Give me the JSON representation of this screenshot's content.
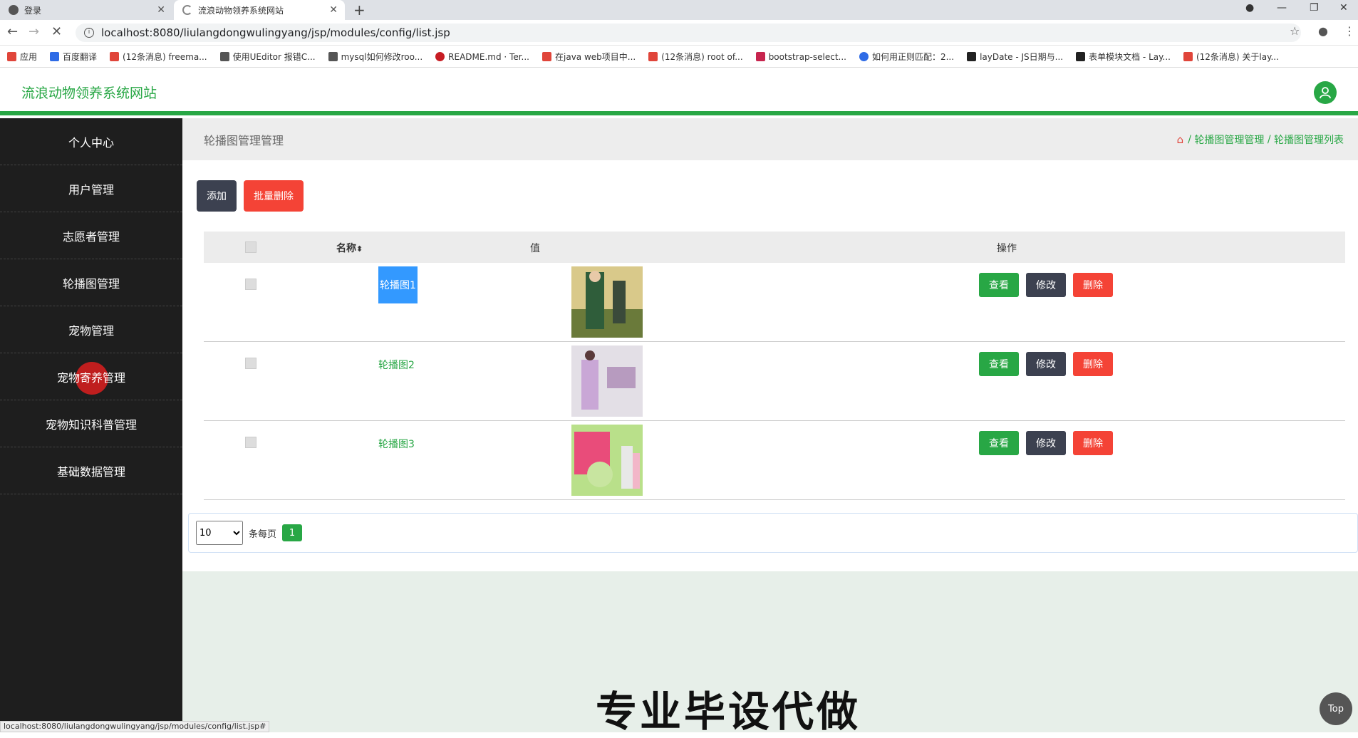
{
  "browser": {
    "tabs": [
      {
        "title": "登录"
      },
      {
        "title": "流浪动物领养系统网站"
      }
    ],
    "url": "localhost:8080/liulangdongwulingyang/jsp/modules/config/list.jsp",
    "bookmarks": [
      {
        "label": "应用",
        "color": "#e0453a"
      },
      {
        "label": "百度翻译",
        "color": "#2e6be6"
      },
      {
        "label": "(12条消息) freema...",
        "color": "#e0453a"
      },
      {
        "label": "使用UEditor 报错C...",
        "color": "#555555"
      },
      {
        "label": "mysql如何修改roo...",
        "color": "#555555"
      },
      {
        "label": "README.md · Ter...",
        "color": "#c71d23"
      },
      {
        "label": "在java web项目中...",
        "color": "#e0453a"
      },
      {
        "label": "(12条消息) root of...",
        "color": "#e0453a"
      },
      {
        "label": "bootstrap-select...",
        "color": "#c7254e"
      },
      {
        "label": "如何用正则匹配：2...",
        "color": "#2e6be6"
      },
      {
        "label": "layDate - JS日期与...",
        "color": "#222222"
      },
      {
        "label": "表单模块文档 - Lay...",
        "color": "#222222"
      },
      {
        "label": "(12条消息) 关于lay...",
        "color": "#e0453a"
      }
    ],
    "status_url": "localhost:8080/liulangdongwulingyang/jsp/modules/config/list.jsp#"
  },
  "header": {
    "site_title": "流浪动物领养系统网站"
  },
  "sidebar": {
    "items": [
      {
        "label": "个人中心"
      },
      {
        "label": "用户管理"
      },
      {
        "label": "志愿者管理"
      },
      {
        "label": "轮播图管理"
      },
      {
        "label": "宠物管理"
      },
      {
        "label": "宠物寄养管理"
      },
      {
        "label": "宠物知识科普管理"
      },
      {
        "label": "基础数据管理"
      }
    ]
  },
  "main": {
    "page_title": "轮播图管理管理",
    "breadcrumb": {
      "sep": "/",
      "level1": "轮播图管理管理",
      "level2": "轮播图管理列表"
    },
    "toolbar": {
      "add_label": "添加",
      "batch_delete_label": "批量删除"
    },
    "table": {
      "headers": {
        "name": "名称",
        "sort_icon": "⬍",
        "value": "值",
        "ops": "操作"
      },
      "rows": [
        {
          "name": "轮播图1"
        },
        {
          "name": "轮播图2"
        },
        {
          "name": "轮播图3"
        }
      ],
      "op_labels": {
        "view": "查看",
        "edit": "修改",
        "delete": "删除"
      }
    },
    "pager": {
      "page_size": "10",
      "per_page_label": "条每页",
      "current_page": "1"
    },
    "watermark": "专业毕设代做",
    "top_button": "Top"
  }
}
